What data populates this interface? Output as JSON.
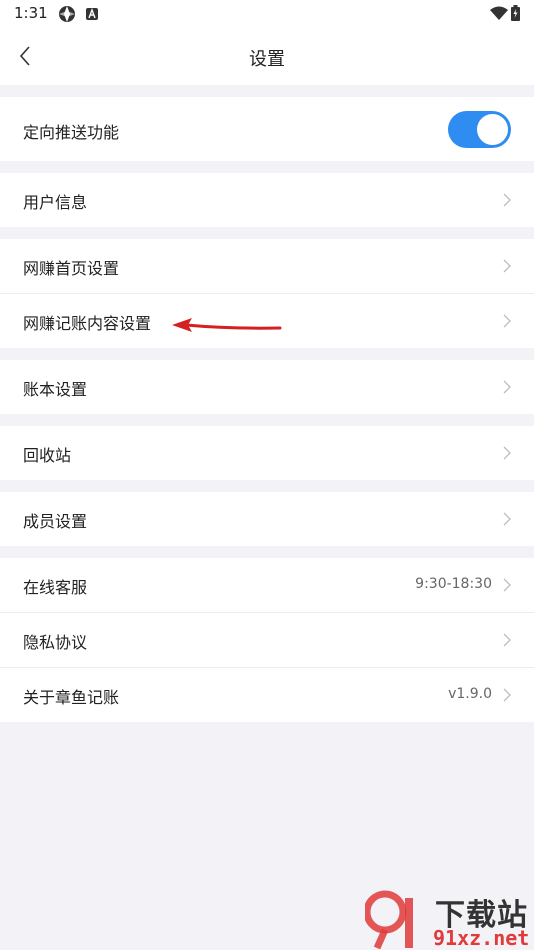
{
  "status_bar": {
    "time": "1:31"
  },
  "header": {
    "title": "设置"
  },
  "settings": {
    "push": {
      "label": "定向推送功能",
      "enabled": true
    },
    "user_info": {
      "label": "用户信息"
    },
    "home_settings": {
      "label": "网赚首页设置"
    },
    "content_settings": {
      "label": "网赚记账内容设置"
    },
    "book_settings": {
      "label": "账本设置"
    },
    "recycle_bin": {
      "label": "回收站"
    },
    "member_settings": {
      "label": "成员设置"
    },
    "customer_service": {
      "label": "在线客服",
      "value": "9:30-18:30"
    },
    "privacy": {
      "label": "隐私协议"
    },
    "about": {
      "label": "关于章鱼记账",
      "value": "v1.9.0"
    }
  },
  "watermark": {
    "title": "下载站",
    "domain": "91xz.net"
  },
  "colors": {
    "toggle_on": "#2f8cf0",
    "arrow": "#d42020",
    "background": "#f3f3f7"
  }
}
